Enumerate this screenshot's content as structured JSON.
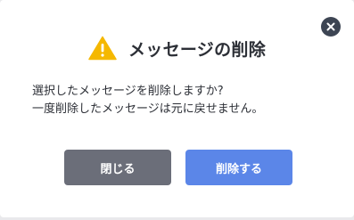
{
  "dialog": {
    "title": "メッセージの削除",
    "title_icon": "warning-triangle-icon",
    "close_icon": "close-icon",
    "message_lines": [
      "選択したメッセージを削除しますか?",
      "一度削除したメッセージは元に戻せません。"
    ],
    "cancel_label": "閉じる",
    "confirm_label": "削除する"
  },
  "colors": {
    "warning": "#f5b800",
    "close_button": "#3d4553",
    "cancel_button": "#6b6e79",
    "confirm_button": "#5b86e8",
    "text": "#2c2f36"
  }
}
